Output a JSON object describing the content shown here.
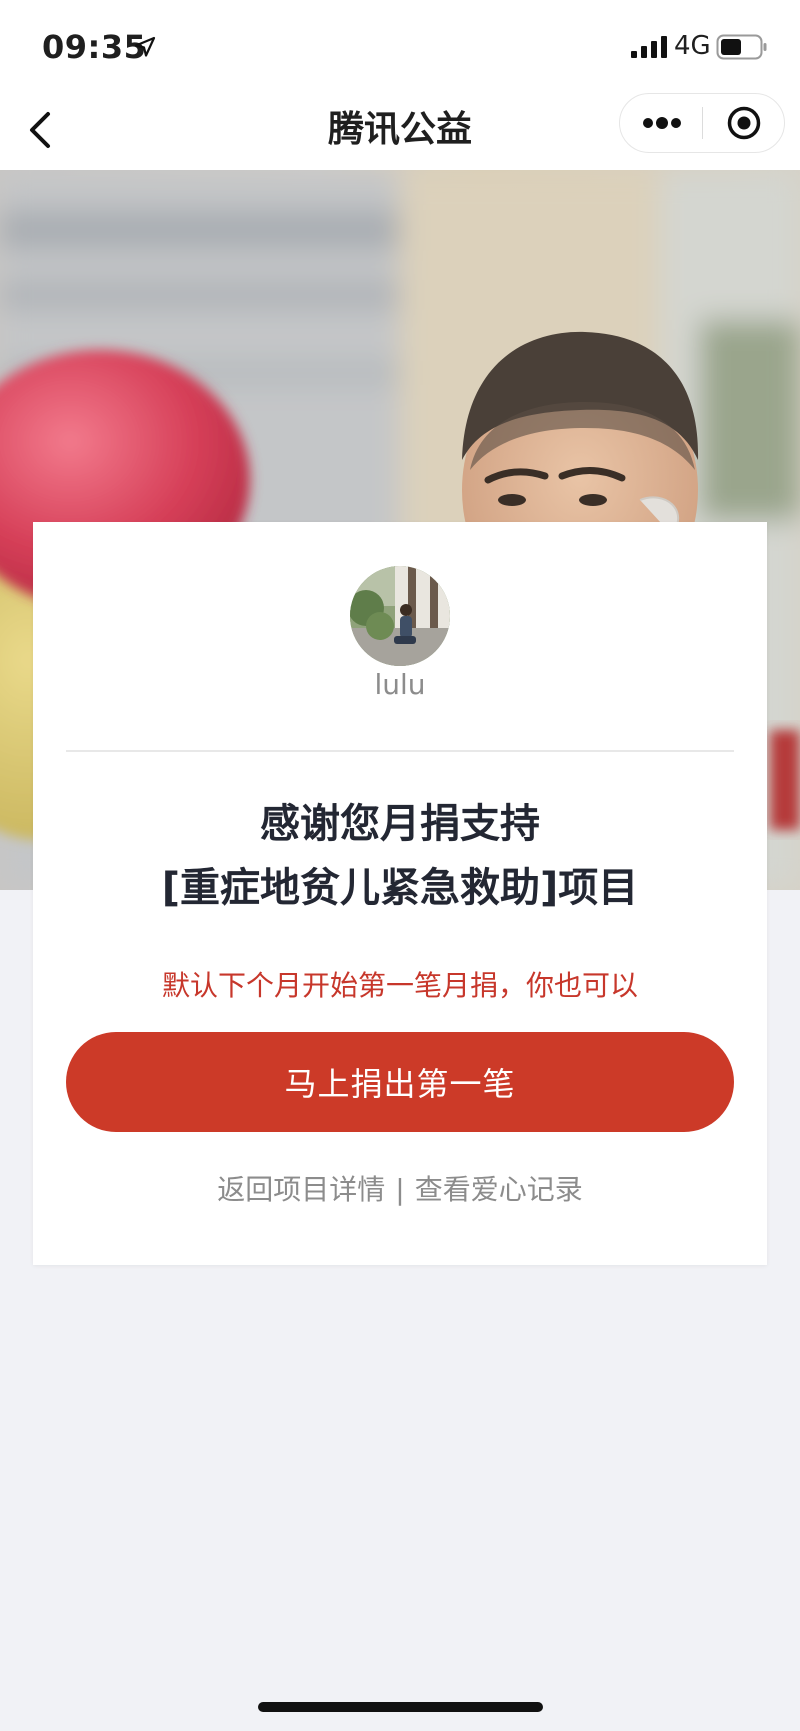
{
  "status_bar": {
    "time": "09:35",
    "network": "4G",
    "icons": [
      "location-arrow-icon",
      "signal-bars-icon",
      "battery-icon"
    ]
  },
  "nav": {
    "title": "腾讯公益",
    "icons": [
      "chevron-left-icon",
      "more-dots-icon",
      "close-target-icon"
    ]
  },
  "card": {
    "username": "lulu",
    "title_line1": "感谢您月捐支持",
    "title_line2": "[重症地贫儿紧急救助]项目",
    "notice": "默认下个月开始第一笔月捐，你也可以",
    "donate_label": "马上捐出第一笔",
    "link_project": "返回项目详情",
    "link_separator": "|",
    "link_records": "查看爱心记录"
  },
  "colors": {
    "accent": "#cc3a28",
    "notice_text": "#c7372b",
    "page_background": "#f1f2f6",
    "muted_text": "#8c8c8c",
    "title_text": "#232733"
  }
}
